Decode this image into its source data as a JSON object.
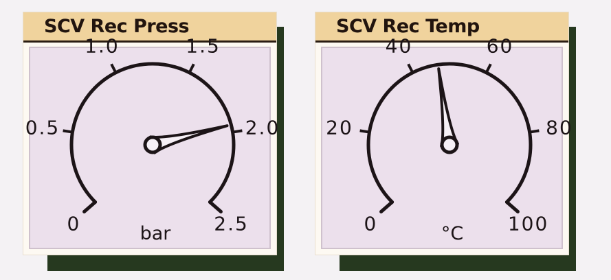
{
  "gauges": [
    {
      "title": "SCV Rec Press",
      "unit": "bar",
      "min": 0,
      "max": 2.5,
      "value": 1.95,
      "ticks": [
        "0",
        "0.5",
        "1.0",
        "1.5",
        "2.0",
        "2.5"
      ],
      "tick_labels_shown": [
        "0",
        "0.5",
        "1.0",
        "1.5",
        "2.0",
        "2.5"
      ]
    },
    {
      "title": "SCV Rec Temp",
      "unit": "°C",
      "min": 0,
      "max": 100,
      "value": 47,
      "ticks": [
        "0",
        "20",
        "40",
        "60",
        "80",
        "100"
      ],
      "tick_labels_shown": [
        "0",
        "20",
        "40",
        "60",
        "80",
        "100"
      ]
    }
  ],
  "colors": {
    "title_bar": "#f0d39d",
    "dial_face": "#ece0ec",
    "panel_shadow": "#26391f",
    "ink": "#1c1417"
  }
}
